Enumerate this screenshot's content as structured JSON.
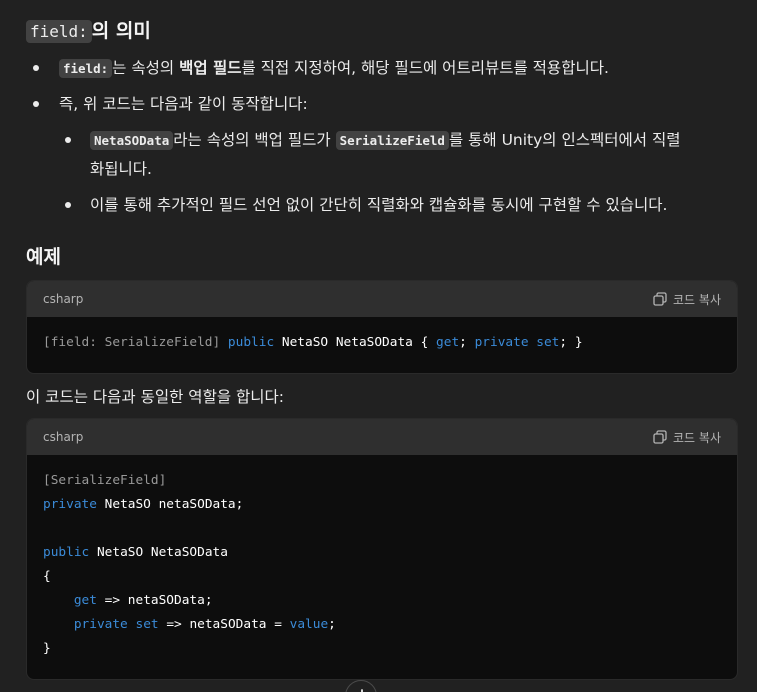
{
  "section1": {
    "heading_code": "field:",
    "heading_text": "의 의미",
    "bullet1": {
      "code": "field:",
      "text_before_bold": "는 속성의 ",
      "bold": "백업 필드",
      "text_after": "를 직접 지정하여, 해당 필드에 어트리뷰트를 적용합니다."
    },
    "bullet2": {
      "text": "즉, 위 코드는 다음과 같이 동작합니다:"
    },
    "sub1": {
      "code1": "NetaSOData",
      "text1": "라는 속성의 백업 필드가 ",
      "code2": "SerializeField",
      "text2_line1": "를 통해 Unity의 인스펙터에서 직렬",
      "text2_line2": "화됩니다."
    },
    "sub2": {
      "text": "이를 통해 추가적인 필드 선언 없이 간단히 직렬화와 캡슐화를 동시에 구현할 수 있습니다."
    }
  },
  "section2": {
    "heading": "예제",
    "code_block1": {
      "language": "csharp",
      "copy_label": "코드 복사",
      "tokens": {
        "attr": "[field: SerializeField]",
        "kw_public": "public",
        "type": "NetaSO",
        "name": "NetaSOData",
        "brace_open": "{",
        "kw_get": "get",
        "semi1": ";",
        "kw_private": "private",
        "kw_set": "set",
        "semi2": ";",
        "brace_close": "}"
      }
    },
    "between_text": "이 코드는 다음과 동일한 역할을 합니다:",
    "code_block2": {
      "language": "csharp",
      "copy_label": "코드 복사",
      "line1_attr": "[SerializeField]",
      "line2_kw": "private",
      "line2_rest": "NetaSO netaSOData;",
      "line4_kw": "public",
      "line4_rest": "NetaSO NetaSOData",
      "line5": "{",
      "line6_kw": "get",
      "line6_rest": "=> netaSOData;",
      "line7_kw1": "private",
      "line7_kw2": "set",
      "line7_mid": "=> netaSOData =",
      "line7_val": "value",
      "line7_end": ";",
      "line8": "}"
    }
  },
  "icons": {
    "copy": "copy-icon",
    "scroll": "scroll-down-icon"
  }
}
